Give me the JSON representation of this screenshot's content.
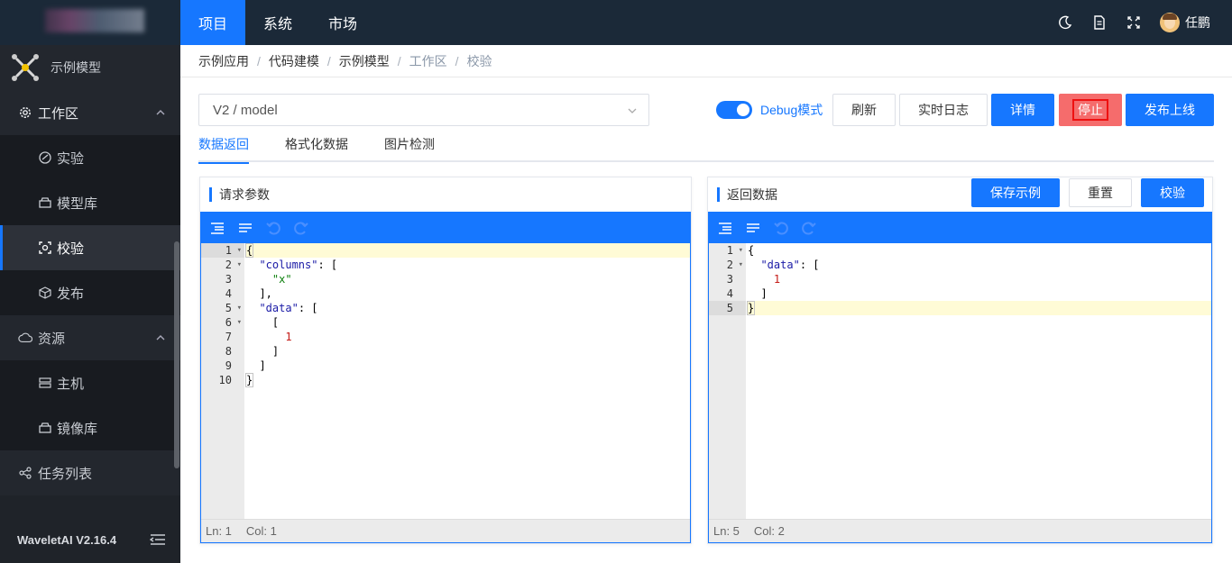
{
  "sidebar": {
    "app_name": "示例模型",
    "groups": [
      {
        "label": "工作区",
        "icon": "gear-icon"
      },
      {
        "label": "资源",
        "icon": "cloud-icon"
      },
      {
        "label": "任务列表",
        "icon": "share-nodes-icon"
      }
    ],
    "workspace_items": [
      {
        "label": "实验",
        "icon": "experiment-icon"
      },
      {
        "label": "模型库",
        "icon": "archive-icon"
      },
      {
        "label": "校验",
        "icon": "scan-icon"
      },
      {
        "label": "发布",
        "icon": "cube-icon"
      }
    ],
    "resource_items": [
      {
        "label": "主机",
        "icon": "server-icon"
      },
      {
        "label": "镜像库",
        "icon": "archive-icon"
      }
    ],
    "version": "WaveletAI V2.16.4"
  },
  "topbar": {
    "nav": [
      "项目",
      "系统",
      "市场"
    ],
    "user_name": "任鹏",
    "icons": [
      "moon-icon",
      "document-icon",
      "fullscreen-icon"
    ]
  },
  "breadcrumb": [
    "示例应用",
    "代码建模",
    "示例模型",
    "工作区",
    "校验"
  ],
  "toolbar": {
    "model_value": "V2 / model",
    "debug_label": "Debug模式",
    "debug_enabled": true,
    "buttons": {
      "refresh": "刷新",
      "realtime_log": "实时日志",
      "detail": "详情",
      "stop": "停止",
      "publish": "发布上线"
    }
  },
  "tabs": [
    "数据返回",
    "格式化数据",
    "图片检测"
  ],
  "request_panel": {
    "title": "请求参数",
    "line_numbers": [
      "1",
      "2",
      "3",
      "4",
      "5",
      "6",
      "7",
      "8",
      "9",
      "10"
    ],
    "status": {
      "ln": "Ln: 1",
      "col": "Col: 1"
    }
  },
  "response_panel": {
    "title": "返回数据",
    "buttons": {
      "save_example": "保存示例",
      "reset": "重置",
      "validate": "校验"
    },
    "line_numbers": [
      "1",
      "2",
      "3",
      "4",
      "5"
    ],
    "status": {
      "ln": "Ln: 5",
      "col": "Col: 2"
    }
  },
  "colors": {
    "accent": "#1677ff",
    "sidebar_bg": "#1f2329",
    "topbar_bg": "#1b2938",
    "danger": "#f56c6c"
  }
}
